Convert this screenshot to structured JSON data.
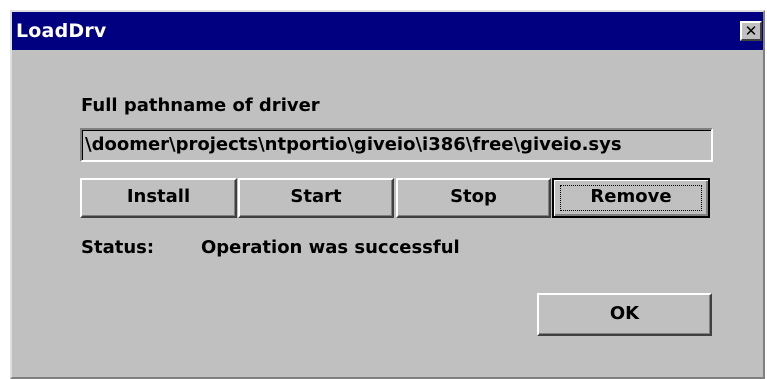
{
  "window": {
    "title": "LoadDrv",
    "close_glyph": "✕"
  },
  "driver": {
    "label": "Full pathname of driver",
    "path_value": "\\doomer\\projects\\ntportio\\giveio\\i386\\free\\giveio.sys"
  },
  "buttons": {
    "install": "Install",
    "start": "Start",
    "stop": "Stop",
    "remove": "Remove",
    "ok": "OK"
  },
  "status": {
    "label": "Status:",
    "value": "Operation was successful"
  },
  "colors": {
    "titlebar": "#000080",
    "face": "#c0c0c0",
    "title_text": "#ffffff"
  }
}
